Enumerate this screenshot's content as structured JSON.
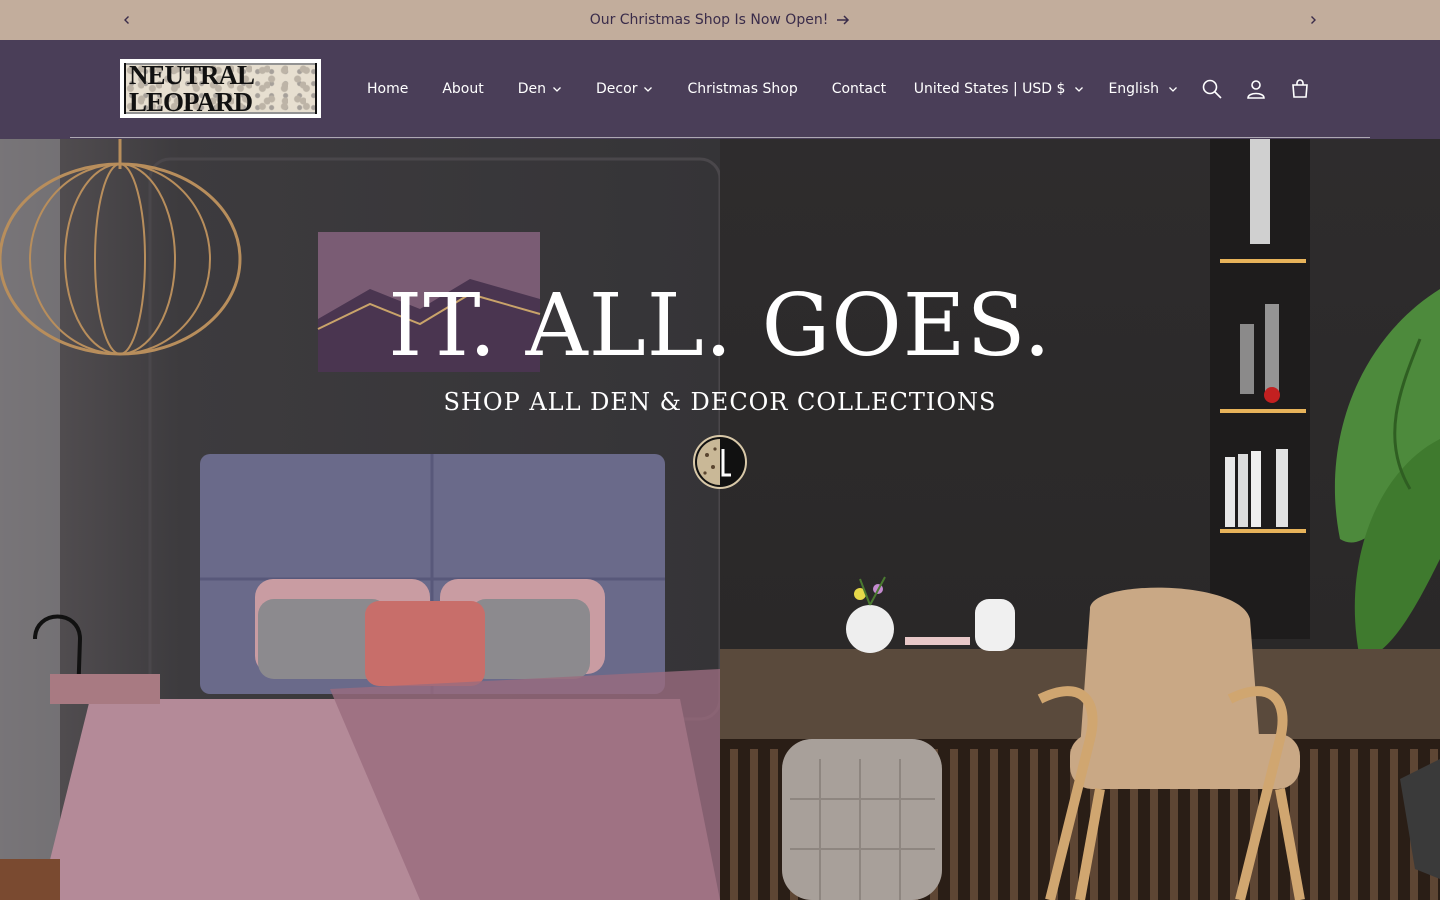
{
  "announcement": {
    "message": "Our Christmas Shop Is Now Open!",
    "prev_icon": "chevron-left-icon",
    "next_icon": "chevron-right-icon"
  },
  "header": {
    "logo_text": "NEUTRAL LEOPARD",
    "nav": [
      {
        "label": "Home",
        "dropdown": false
      },
      {
        "label": "About",
        "dropdown": false
      },
      {
        "label": "Den",
        "dropdown": true
      },
      {
        "label": "Decor",
        "dropdown": true
      },
      {
        "label": "Christmas Shop",
        "dropdown": false
      },
      {
        "label": "Contact",
        "dropdown": false
      }
    ],
    "country_selector": "United States | USD $",
    "language_selector": "English",
    "icons": [
      "search-icon",
      "account-icon",
      "cart-icon"
    ]
  },
  "hero": {
    "title": "IT. ALL. GOES.",
    "subtitle": "SHOP ALL DEN & DECOR COLLECTIONS"
  },
  "colors": {
    "announcement_bg": "#c2ad9c",
    "header_bg": "#4a3e58",
    "text_light": "#ffffff"
  }
}
